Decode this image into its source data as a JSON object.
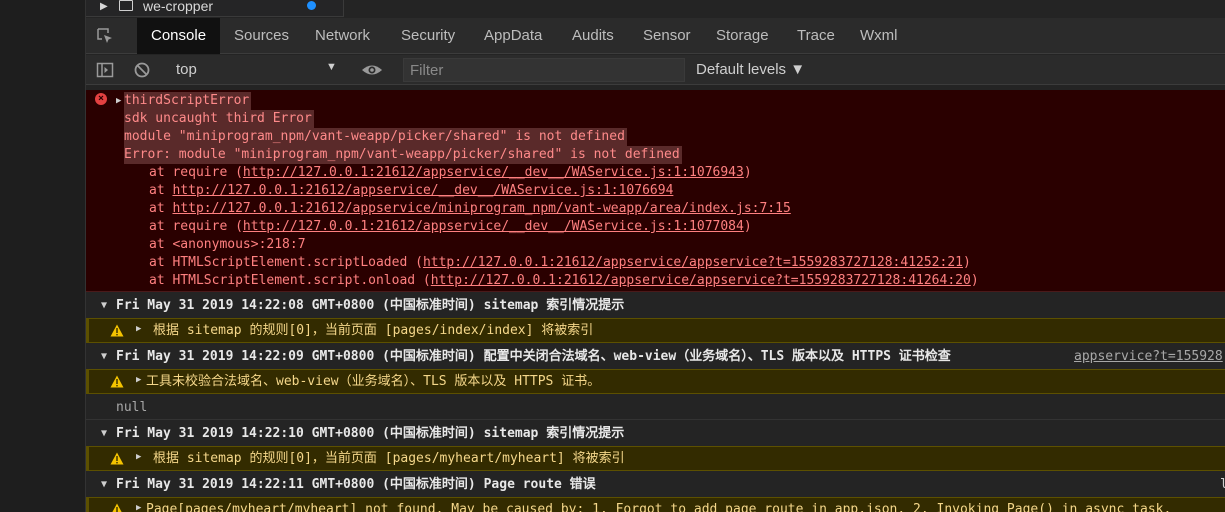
{
  "file_tree": {
    "folder_name": "we-cropper"
  },
  "tabs": [
    "Console",
    "Sources",
    "Network",
    "Security",
    "AppData",
    "Audits",
    "Sensor",
    "Storage",
    "Trace",
    "Wxml"
  ],
  "toolbar": {
    "context": "top",
    "filter_placeholder": "Filter",
    "levels": "Default levels ▼"
  },
  "error": {
    "lines": [
      "thirdScriptError",
      "sdk uncaught third Error",
      "module \"miniprogram_npm/vant-weapp/picker/shared\" is not defined",
      "Error: module \"miniprogram_npm/vant-weapp/picker/shared\" is not defined"
    ],
    "stack": [
      {
        "pre": "at require (",
        "link": "http://127.0.0.1:21612/appservice/__dev__/WAService.js:1:1076943",
        "post": ")"
      },
      {
        "pre": "at ",
        "link": "http://127.0.0.1:21612/appservice/__dev__/WAService.js:1:1076694",
        "post": ""
      },
      {
        "pre": "at ",
        "link": "http://127.0.0.1:21612/appservice/miniprogram_npm/vant-weapp/area/index.js:7:15",
        "post": ""
      },
      {
        "pre": "at require (",
        "link": "http://127.0.0.1:21612/appservice/__dev__/WAService.js:1:1077084",
        "post": ")"
      },
      {
        "pre": "at <anonymous>:218:7",
        "link": "",
        "post": ""
      },
      {
        "pre": "at HTMLScriptElement.scriptLoaded (",
        "link": "http://127.0.0.1:21612/appservice/appservice?t=1559283727128:41252:21",
        "post": ")"
      },
      {
        "pre": "at HTMLScriptElement.script.onload (",
        "link": "http://127.0.0.1:21612/appservice/appservice?t=1559283727128:41264:20",
        "post": ")"
      }
    ]
  },
  "groups": [
    {
      "header": "Fri May 31 2019 14:22:08 GMT+0800 (中国标准时间) sitemap 索引情况提示",
      "warning": "根据 sitemap 的规则[0]，当前页面 [pages/index/index] 将被索引"
    },
    {
      "header": "Fri May 31 2019 14:22:09 GMT+0800 (中国标准时间) 配置中关闭合法域名、web-view（业务域名）、TLS 版本以及 HTTPS 证书检查",
      "link": "appservice?t=155928",
      "warning": "工具未校验合法域名、web-view（业务域名）、TLS 版本以及 HTTPS 证书。"
    },
    {
      "null_text": "null"
    },
    {
      "header": "Fri May 31 2019 14:22:10 GMT+0800 (中国标准时间) sitemap 索引情况提示",
      "warning": "根据 sitemap 的规则[0]，当前页面 [pages/myheart/myheart] 将被索引"
    },
    {
      "header": "Fri May 31 2019 14:22:11 GMT+0800 (中国标准时间) Page route 错误",
      "edge": "l",
      "warning": "Page[pages/myheart/myheart] not found. May be caused by: 1. Forgot to add page route in app.json. 2. Invoking Page() in async task."
    }
  ]
}
